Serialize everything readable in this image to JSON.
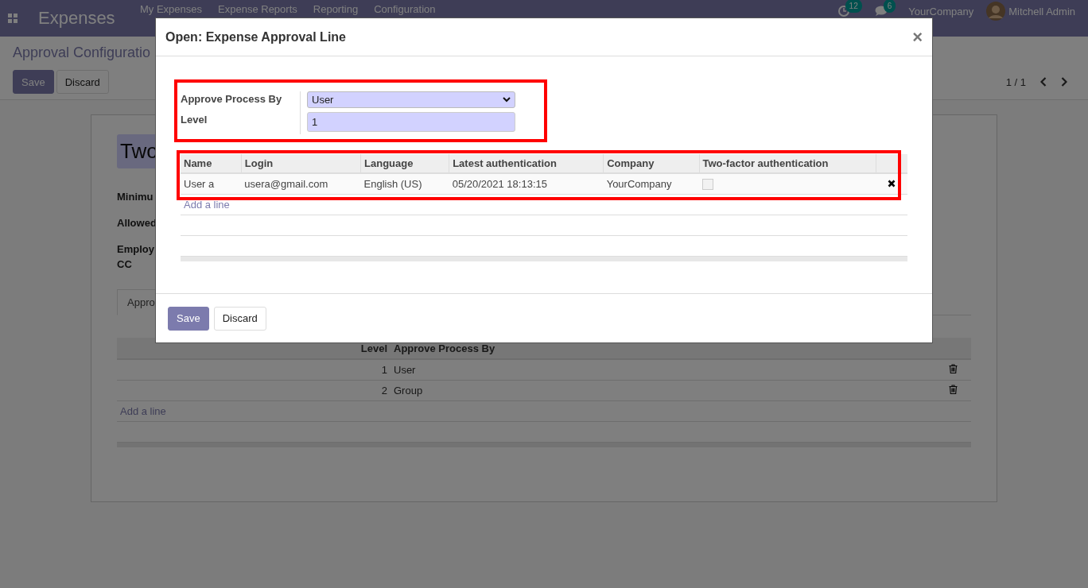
{
  "navbar": {
    "app_title": "Expenses",
    "menu": [
      "My Expenses",
      "Expense Reports",
      "Reporting",
      "Configuration"
    ],
    "activity_count": "12",
    "message_count": "6",
    "company": "YourCompany",
    "user": "Mitchell Admin"
  },
  "control_panel": {
    "breadcrumb": "Approval Configuratio",
    "buttons": [
      {
        "label": "Save",
        "kind": "primary"
      },
      {
        "label": "Discard",
        "kind": "secondary"
      }
    ],
    "pager": "1 / 1"
  },
  "form": {
    "title_value": "Two",
    "labels": [
      {
        "lines": [
          "Minimu"
        ]
      },
      {
        "lines": [
          "Allowed"
        ]
      },
      {
        "lines": [
          "Employ",
          "CC"
        ]
      }
    ],
    "tabs": [
      {
        "label": "Appro",
        "selected": true
      }
    ],
    "table": {
      "columns": [
        "Level",
        "Approve Process By"
      ],
      "rows": [
        {
          "level": "1",
          "approve_process_by": "User"
        },
        {
          "level": "2",
          "approve_process_by": "Group"
        }
      ],
      "add_line": "Add a line"
    }
  },
  "dialog": {
    "title": "Open: Expense Approval Line",
    "close": "×",
    "fields": [
      {
        "label": "Approve Process By",
        "kind": "select",
        "value": "User"
      },
      {
        "label": "Level",
        "kind": "input",
        "value": "1"
      }
    ],
    "table": {
      "columns": [
        "Name",
        "Login",
        "Language",
        "Latest authentication",
        "Company",
        "Two-factor authentication"
      ],
      "rows": [
        {
          "cells": [
            "User a",
            "usera@gmail.com",
            "English (US)",
            "05/20/2021 18:13:15",
            "YourCompany"
          ],
          "two_factor": false
        }
      ],
      "add_line": "Add a line"
    },
    "buttons": [
      {
        "label": "Save",
        "kind": "primary"
      },
      {
        "label": "Discard",
        "kind": "secondary"
      }
    ]
  }
}
